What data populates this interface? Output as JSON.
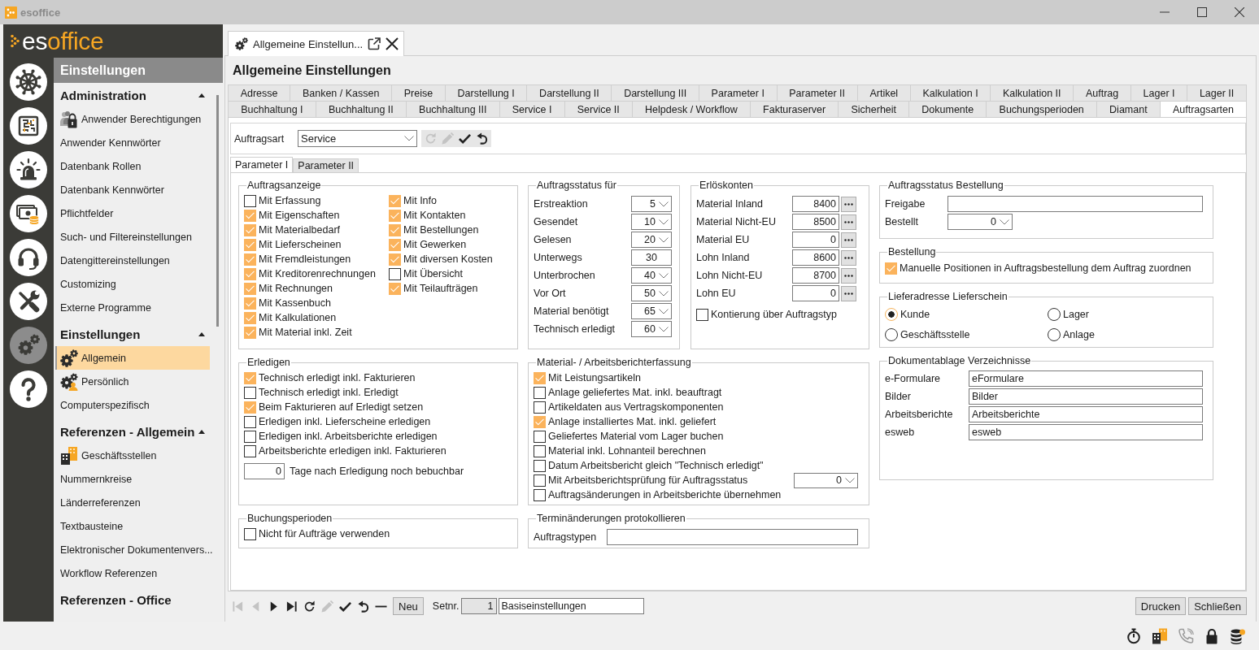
{
  "window": {
    "title": "esoffice"
  },
  "logo": {
    "parts": [
      "es",
      "office"
    ]
  },
  "rail": [
    {
      "kind": "helm",
      "selected": false
    },
    {
      "kind": "board",
      "selected": false
    },
    {
      "kind": "alarm",
      "selected": false
    },
    {
      "kind": "cash",
      "selected": false
    },
    {
      "kind": "headset",
      "selected": false
    },
    {
      "kind": "tools",
      "selected": false
    },
    {
      "kind": "gears",
      "selected": true
    },
    {
      "kind": "help",
      "selected": false
    }
  ],
  "nav": {
    "title": "Einstellungen",
    "sections": [
      {
        "title": "Administration",
        "expanded": true,
        "items": [
          {
            "label": "Anwender Berechtigungen",
            "kind": "lock",
            "selected": false
          },
          {
            "label": "Anwender Kennwörter",
            "kind": "plain",
            "selected": false
          },
          {
            "label": "Datenbank Rollen",
            "kind": "plain",
            "selected": false
          },
          {
            "label": "Datenbank Kennwörter",
            "kind": "plain",
            "selected": false
          },
          {
            "label": "Pflichtfelder",
            "kind": "plain",
            "selected": false
          },
          {
            "label": "Such- und Filtereinstellungen",
            "kind": "plain",
            "selected": false
          },
          {
            "label": "Datengittereinstellungen",
            "kind": "plain",
            "selected": false
          },
          {
            "label": "Customizing",
            "kind": "plain",
            "selected": false
          },
          {
            "label": "Externe Programme",
            "kind": "plain",
            "selected": false
          }
        ]
      },
      {
        "title": "Einstellungen",
        "expanded": true,
        "items": [
          {
            "label": "Allgemein",
            "kind": "gears",
            "selected": true
          },
          {
            "label": "Persönlich",
            "kind": "gear-person",
            "selected": false
          },
          {
            "label": "Computerspezifisch",
            "kind": "plain",
            "selected": false
          }
        ]
      },
      {
        "title": "Referenzen - Allgemein",
        "expanded": true,
        "items": [
          {
            "label": "Geschäftsstellen",
            "kind": "building",
            "selected": false
          },
          {
            "label": "Nummernkreise",
            "kind": "plain",
            "selected": false
          },
          {
            "label": "Länderreferenzen",
            "kind": "plain",
            "selected": false
          },
          {
            "label": "Textbausteine",
            "kind": "plain",
            "selected": false
          },
          {
            "label": "Elektronischer Dokumentenvers...",
            "kind": "plain",
            "selected": false
          },
          {
            "label": "Workflow Referenzen",
            "kind": "plain",
            "selected": false
          }
        ]
      },
      {
        "title": "Referenzen - Office"
      }
    ]
  },
  "document_tab": {
    "title": "Allgemeine Einstellun..."
  },
  "heading": "Allgemeine Einstellungen",
  "tab_rows": [
    [
      {
        "label": "Adresse",
        "selected": false
      },
      {
        "label": "Banken / Kassen",
        "selected": false
      },
      {
        "label": "Preise",
        "selected": false
      },
      {
        "label": "Darstellung I",
        "selected": false
      },
      {
        "label": "Darstellung II",
        "selected": false
      },
      {
        "label": "Darstellung III",
        "selected": false
      },
      {
        "label": "Parameter I",
        "selected": false
      },
      {
        "label": "Parameter II",
        "selected": false
      },
      {
        "label": "Artikel",
        "selected": false
      },
      {
        "label": "Kalkulation I",
        "selected": false
      },
      {
        "label": "Kalkulation II",
        "selected": false
      },
      {
        "label": "Auftrag",
        "selected": false
      },
      {
        "label": "Lager I",
        "selected": false
      },
      {
        "label": "Lager II",
        "selected": false
      }
    ],
    [
      {
        "label": "Buchhaltung I",
        "selected": false
      },
      {
        "label": "Buchhaltung II",
        "selected": false
      },
      {
        "label": "Buchhaltung III",
        "selected": false
      },
      {
        "label": "Service I",
        "selected": false
      },
      {
        "label": "Service II",
        "selected": false
      },
      {
        "label": "Helpdesk / Workflow",
        "selected": false
      },
      {
        "label": "Fakturaserver",
        "selected": false
      },
      {
        "label": "Sicherheit",
        "selected": false
      },
      {
        "label": "Dokumente",
        "selected": false
      },
      {
        "label": "Buchungsperioden",
        "selected": false
      },
      {
        "label": "Diamant",
        "selected": false
      },
      {
        "label": "Auftragsarten",
        "selected": true
      }
    ]
  ],
  "order_type": {
    "label": "Auftragsart",
    "value": "Service",
    "tools": [
      {
        "kind": "refresh",
        "disabled": true
      },
      {
        "kind": "edit",
        "disabled": true
      },
      {
        "kind": "save",
        "disabled": false
      },
      {
        "kind": "undo",
        "disabled": false
      }
    ]
  },
  "sub_tabs": [
    {
      "label": "Parameter I",
      "selected": true
    },
    {
      "label": "Parameter II",
      "selected": false
    }
  ],
  "order_display": {
    "title": "Auftragsanzeige",
    "columns": [
      [
        {
          "label": "Mit Erfassung",
          "checked": false
        },
        {
          "label": "Mit Eigenschaften",
          "checked": true
        },
        {
          "label": "Mit Materialbedarf",
          "checked": true
        },
        {
          "label": "Mit Lieferscheinen",
          "checked": true
        },
        {
          "label": "Mit Fremdleistungen",
          "checked": true
        },
        {
          "label": "Mit Kreditorenrechnungen",
          "checked": true
        },
        {
          "label": "Mit Rechnungen",
          "checked": true
        },
        {
          "label": "Mit Kassenbuch",
          "checked": true
        },
        {
          "label": "Mit Kalkulationen",
          "checked": true
        },
        {
          "label": "Mit Material inkl. Zeit",
          "checked": true
        }
      ],
      [
        {
          "label": "Mit Info",
          "checked": true
        },
        {
          "label": "Mit Kontakten",
          "checked": true
        },
        {
          "label": "Mit Bestellungen",
          "checked": true
        },
        {
          "label": "Mit Gewerken",
          "checked": true
        },
        {
          "label": "Mit diversen Kosten",
          "checked": true
        },
        {
          "label": "Mit Übersicht",
          "checked": false
        },
        {
          "label": "Mit Teilaufträgen",
          "checked": true
        }
      ]
    ]
  },
  "status_for": {
    "title": "Auftragsstatus für",
    "rows": [
      {
        "label": "Erstreaktion",
        "value": "5",
        "kind": "dropdown"
      },
      {
        "label": "Gesendet",
        "value": "10",
        "kind": "dropdown"
      },
      {
        "label": "Gelesen",
        "value": "20",
        "kind": "dropdown"
      },
      {
        "label": "Unterwegs",
        "value": "30",
        "kind": "number"
      },
      {
        "label": "Unterbrochen",
        "value": "40",
        "kind": "dropdown"
      },
      {
        "label": "Vor Ort",
        "value": "50",
        "kind": "dropdown"
      },
      {
        "label": "Material benötigt",
        "value": "65",
        "kind": "dropdown"
      },
      {
        "label": "Technisch erledigt",
        "value": "60",
        "kind": "dropdown"
      }
    ]
  },
  "revenue_accounts": {
    "title": "Erlöskonten",
    "rows": [
      {
        "label": "Material Inland",
        "value": "8400"
      },
      {
        "label": "Material Nicht-EU",
        "value": "8500"
      },
      {
        "label": "Material EU",
        "value": "0"
      },
      {
        "label": "Lohn Inland",
        "value": "8600"
      },
      {
        "label": "Lohn Nicht-EU",
        "value": "8700"
      },
      {
        "label": "Lohn EU",
        "value": "0"
      }
    ],
    "option": {
      "label": "Kontierung über Auftragstyp",
      "checked": false
    }
  },
  "complete": {
    "title": "Erledigen",
    "options": [
      {
        "label": "Technisch erledigt inkl. Fakturieren",
        "checked": true
      },
      {
        "label": "Technisch erledigt inkl. Erledigt",
        "checked": false
      },
      {
        "label": "Beim Fakturieren auf Erledigt setzen",
        "checked": true
      },
      {
        "label": "Erledigen inkl. Lieferscheine erledigen",
        "checked": false
      },
      {
        "label": "Erledigen inkl. Arbeitsberichte erledigen",
        "checked": false
      },
      {
        "label": "Arbeitsberichte erledigen inkl. Fakturieren",
        "checked": false
      }
    ],
    "days": {
      "value": "0",
      "label": "Tage nach Erledigung noch bebuchbar"
    }
  },
  "booking_periods": {
    "title": "Buchungsperioden",
    "options": [
      {
        "label": "Nicht für Aufträge verwenden",
        "checked": false
      }
    ]
  },
  "work_report": {
    "title": "Material- / Arbeitsberichterfassung",
    "options": [
      {
        "label": "Mit Leistungsartikeln",
        "checked": true
      },
      {
        "label": "Anlage geliefertes Mat. inkl. beauftragt",
        "checked": false
      },
      {
        "label": "Artikeldaten aus Vertragskomponenten",
        "checked": false
      },
      {
        "label": "Anlage installiertes Mat. inkl. geliefert",
        "checked": true
      },
      {
        "label": "Geliefertes Material vom Lager buchen",
        "checked": false
      },
      {
        "label": "Material inkl. Lohnanteil berechnen",
        "checked": false
      },
      {
        "label": "Datum Arbeitsbericht gleich \"Technisch erledigt\"",
        "checked": false
      },
      {
        "label": "Mit Arbeitsberichtsprüfung für Auftragsstatus",
        "checked": false,
        "value": "0"
      },
      {
        "label": "Auftragsänderungen in Arbeitsberichte übernehmen",
        "checked": false
      }
    ]
  },
  "schedule_log": {
    "title": "Terminänderungen protokollieren",
    "label": "Auftragstypen"
  },
  "order_status_purchase": {
    "title": "Auftragsstatus Bestellung",
    "rows": [
      {
        "label": "Freigabe",
        "kind": "text"
      },
      {
        "label": "Bestellt",
        "kind": "dropdown",
        "value": "0"
      }
    ]
  },
  "purchase": {
    "title": "Bestellung",
    "option": {
      "label": "Manuelle Positionen in Auftragsbestellung dem Auftrag zuordnen",
      "checked": true
    }
  },
  "delivery_address": {
    "title": "Lieferadresse Lieferschein",
    "options": [
      {
        "label": "Kunde",
        "selected": true
      },
      {
        "label": "Lager",
        "selected": false
      },
      {
        "label": "Geschäftsstelle",
        "selected": false
      },
      {
        "label": "Anlage",
        "selected": false
      }
    ]
  },
  "document_folders": {
    "title": "Dokumentablage Verzeichnisse",
    "rows": [
      {
        "label": "e-Formulare",
        "value": "eFormulare"
      },
      {
        "label": "Bilder",
        "value": "Bilder"
      },
      {
        "label": "Arbeitsberichte",
        "value": "Arbeitsberichte"
      },
      {
        "label": "esweb",
        "value": "esweb"
      }
    ]
  },
  "record_bar": {
    "tools": [
      {
        "kind": "first",
        "disabled": true
      },
      {
        "kind": "previous",
        "disabled": true
      },
      {
        "kind": "next",
        "disabled": false
      },
      {
        "kind": "last",
        "disabled": false
      },
      {
        "kind": "refresh",
        "disabled": false
      },
      {
        "kind": "edit",
        "disabled": true
      },
      {
        "kind": "save",
        "disabled": false
      },
      {
        "kind": "undo",
        "disabled": false
      },
      {
        "kind": "remove",
        "disabled": false
      }
    ],
    "new_button": "Neu",
    "set_label": "Setnr.",
    "set_number": "1",
    "set_name": "Basiseinstellungen",
    "buttons": [
      "Drucken",
      "Schließen"
    ]
  },
  "status_bar": {
    "icons": [
      {
        "kind": "stopwatch"
      },
      {
        "kind": "buildings"
      },
      {
        "kind": "phone"
      },
      {
        "kind": "lock"
      },
      {
        "kind": "database"
      }
    ]
  }
}
